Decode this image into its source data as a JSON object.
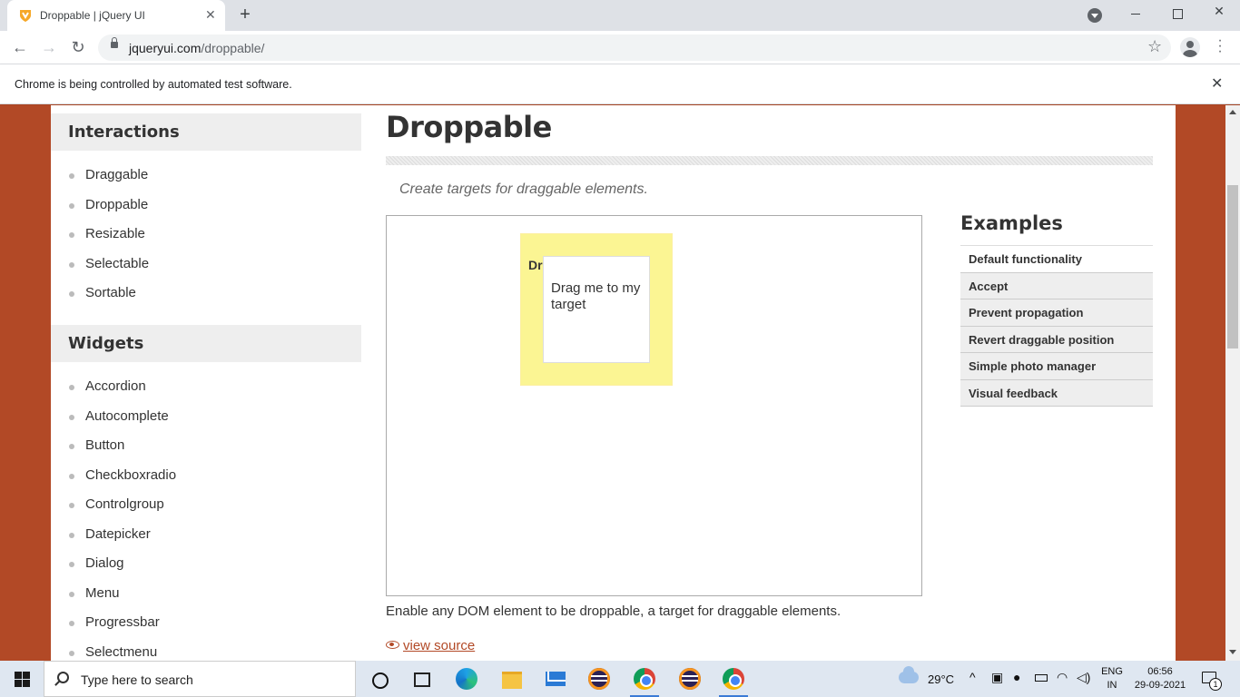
{
  "browser": {
    "tab_title": "Droppable | jQuery UI",
    "tab_close": "✕",
    "new_tab": "+",
    "url_domain": "jqueryui.com",
    "url_path": "/droppable/",
    "infobar_text": "Chrome is being controlled by automated test software.",
    "infobar_close": "✕",
    "icons": [
      "favicon-icon",
      "back-icon",
      "forward-icon",
      "reload-icon",
      "lock-icon",
      "star-icon",
      "profile-icon",
      "menu-icon"
    ]
  },
  "sidebar": {
    "sections": [
      {
        "title": "Interactions",
        "items": [
          "Draggable",
          "Droppable",
          "Resizable",
          "Selectable",
          "Sortable"
        ]
      },
      {
        "title": "Widgets",
        "items": [
          "Accordion",
          "Autocomplete",
          "Button",
          "Checkboxradio",
          "Controlgroup",
          "Datepicker",
          "Dialog",
          "Menu",
          "Progressbar",
          "Selectmenu"
        ]
      }
    ]
  },
  "main": {
    "title": "Droppable",
    "subtitle": "Create targets for draggable elements.",
    "demo": {
      "droppable_text": "Dr",
      "draggable_text": "Drag me to my target"
    },
    "description": "Enable any DOM element to be droppable, a target for draggable elements.",
    "view_source": "view source"
  },
  "examples": {
    "title": "Examples",
    "items": [
      "Default functionality",
      "Accept",
      "Prevent propagation",
      "Revert draggable position",
      "Simple photo manager",
      "Visual feedback"
    ],
    "active_index": 0
  },
  "taskbar": {
    "search_placeholder": "Type here to search",
    "weather": "29°C",
    "lang_line1": "ENG",
    "lang_line2": "IN",
    "time": "06:56",
    "date": "29-09-2021",
    "notification_count": "1"
  },
  "colors": {
    "page_background": "#b24926",
    "droppable_background": "#fbf593",
    "link": "#b24926"
  }
}
